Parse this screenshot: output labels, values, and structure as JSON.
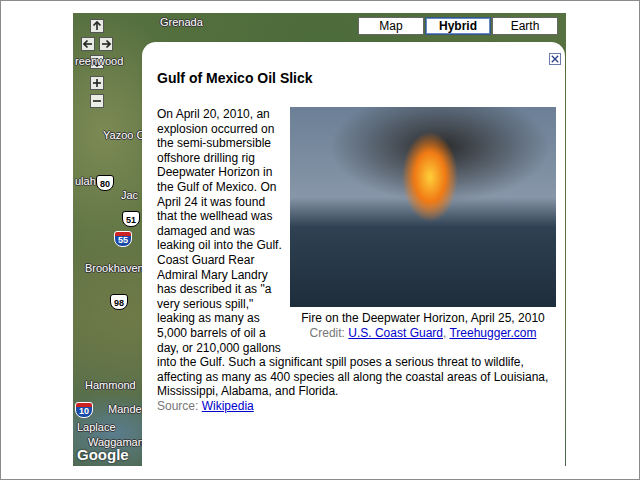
{
  "map_type_buttons": [
    {
      "label": "Map",
      "selected": false
    },
    {
      "label": "Hybrid",
      "selected": true
    },
    {
      "label": "Earth",
      "selected": false
    }
  ],
  "map_labels": [
    "Grenada",
    "reenwood",
    "Yazoo C",
    "ulah",
    "Jac",
    "Brookhaven",
    "Hammond",
    "Mandev",
    "Laplace",
    "Waggaman"
  ],
  "highway_shields": [
    {
      "text": "80",
      "kind": "us"
    },
    {
      "text": "51",
      "kind": "us"
    },
    {
      "text": "55",
      "kind": "interstate"
    },
    {
      "text": "98",
      "kind": "us"
    },
    {
      "text": "10",
      "kind": "interstate"
    }
  ],
  "info_window": {
    "title": "Gulf of Mexico Oil Slick",
    "body": "On April 20, 2010, an explosion occurred on the semi-submersible offshore drilling rig Deepwater Horizon in the Gulf of Mexico. On April 24 it was found that the wellhead was damaged and was leaking oil into the Gulf. Coast Guard Rear Admiral Mary Landry has described it as \"a very serious spill,\" leaking as many as 5,000 barrels of oil a day, or 210,000 gallons into the Gulf. Such a significant spill poses a serious threat to wildlife, affecting as many as 400 species all along the coastal areas of Louisiana, Mississippi, Alabama, and Florida.",
    "image_caption": "Fire on the Deepwater Horizon, April 25, 2010",
    "credit_label": "Credit:",
    "credit_links": [
      "U.S. Coast Guard",
      "Treehugger.com"
    ],
    "credit_separator": ",",
    "source_label": "Source:",
    "source_link": "Wikipedia"
  },
  "logo": "Google"
}
